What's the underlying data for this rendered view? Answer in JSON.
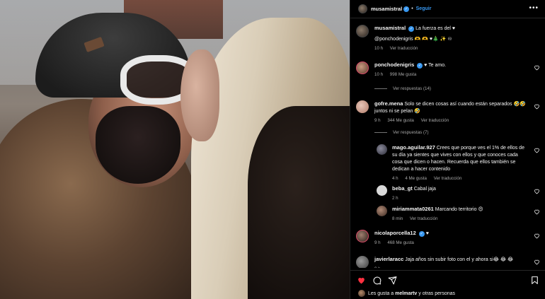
{
  "post": {
    "author": "musamistral",
    "follow_label": "Seguir",
    "caption": "La fuerza es del ♥",
    "caption_line2": "@ponchodenigris 🫶 🫶 ♥🎄 ✨ ♾",
    "caption_time": "10 h",
    "see_translation": "Ver traducción"
  },
  "comments": [
    {
      "user": "ponchodenigris",
      "verified": true,
      "text": "♥ Te amo.",
      "time": "10 h",
      "likes": "998 Me gusta",
      "replies": "Ver respuestas (14)"
    },
    {
      "user": "gofre.mena",
      "verified": false,
      "text": "Solo se dicen cosas así cuando están separados 🤣🤣 juntos ni se pelan 🤣",
      "time": "9 h",
      "likes": "344 Me gusta",
      "translate": "Ver traducción",
      "replies": "Ver respuestas (7)"
    },
    {
      "user": "nicolaporcella12",
      "verified": true,
      "text": "♥",
      "time": "9 h",
      "likes": "468 Me gusta"
    },
    {
      "user": "javierlaracc",
      "verified": false,
      "text": "Jaja años sin subir foto con el y ahora si😂 😂 😂",
      "time": "9 h",
      "likes": "",
      "replies": ""
    }
  ],
  "replies": [
    {
      "user": "mago.aguilar.927",
      "text": "Crees que porque ves el 1% de ellos de su día ya sientes que vives con ellos y que conoces cada cosa que dicen o hacen. Recuerda que ellos también se dedican a hacer contenido",
      "time": "4 h",
      "likes": "4 Me gusta",
      "translate": "Ver traducción"
    },
    {
      "user": "beba_gt",
      "text": "Cabal jaja",
      "time": "2 h"
    },
    {
      "user": "miriammata0261",
      "text": "Marcando territorio 😍",
      "time": "8 min",
      "translate": "Ver traducción"
    }
  ],
  "likes_summary": {
    "prefix": "Les gusta a",
    "user": "melmartv",
    "suffix": "y otras personas"
  },
  "icons": {
    "like": "heart-filled-icon",
    "comment": "comment-icon",
    "share": "share-icon",
    "save": "bookmark-icon",
    "more": "more-horizontal-icon"
  },
  "colors": {
    "accent": "#3797f0",
    "like": "#ff3040",
    "muted": "#a8a8a8"
  }
}
